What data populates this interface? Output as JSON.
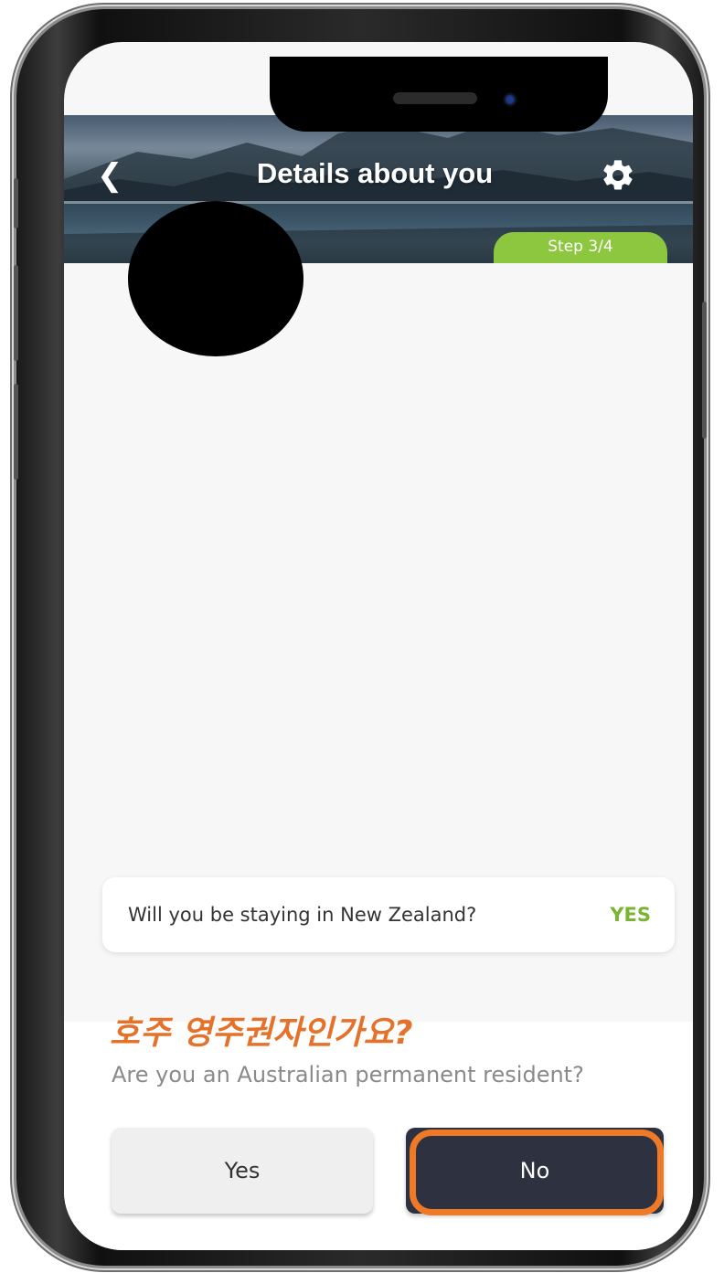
{
  "header": {
    "title": "Details about you",
    "back_icon": "chevron-left-icon",
    "settings_icon": "gear-icon",
    "step_label": "Step 3/4"
  },
  "answered": {
    "question": "Will you be staying in New Zealand?",
    "answer": "YES"
  },
  "prompt": {
    "annotation_korean": "호주 영주권자인가요?",
    "question": "Are you an Australian permanent resident?"
  },
  "buttons": {
    "yes_label": "Yes",
    "no_label": "No"
  },
  "colors": {
    "accent_green": "#8dc63f",
    "answer_green": "#7ab532",
    "primary_button": "#2d3140",
    "highlight_orange": "#ee7a28"
  }
}
